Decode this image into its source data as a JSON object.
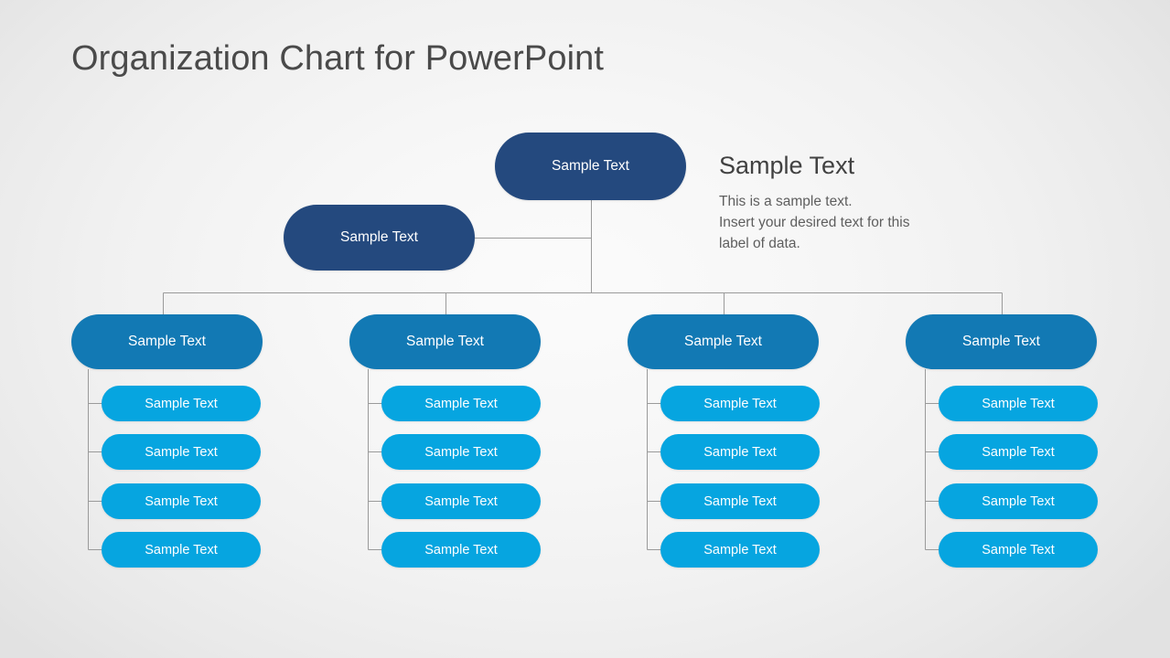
{
  "slide": {
    "title": "Organization Chart for PowerPoint",
    "background_color": "#f4f4f4"
  },
  "annotation": {
    "heading": "Sample Text",
    "body_lines": [
      "This is a sample text.",
      "Insert your desired text for this",
      "label of data."
    ]
  },
  "colors": {
    "level1": "#24497e",
    "level2": "#24497e",
    "level3": "#1279b4",
    "leaf": "#06a5e0",
    "connector": "#9a9a9a",
    "title_text": "#4a4a4a",
    "node_text": "#ffffff"
  },
  "chart": {
    "type": "org-chart",
    "top_node": {
      "label": "Sample Text",
      "level": 1
    },
    "second_node": {
      "label": "Sample Text",
      "level": 2
    },
    "columns": [
      {
        "parent": {
          "label": "Sample Text",
          "level": 3
        },
        "children": [
          {
            "label": "Sample Text"
          },
          {
            "label": "Sample Text"
          },
          {
            "label": "Sample Text"
          },
          {
            "label": "Sample Text"
          }
        ]
      },
      {
        "parent": {
          "label": "Sample Text",
          "level": 3
        },
        "children": [
          {
            "label": "Sample Text"
          },
          {
            "label": "Sample Text"
          },
          {
            "label": "Sample Text"
          },
          {
            "label": "Sample Text"
          }
        ]
      },
      {
        "parent": {
          "label": "Sample Text",
          "level": 3
        },
        "children": [
          {
            "label": "Sample Text"
          },
          {
            "label": "Sample Text"
          },
          {
            "label": "Sample Text"
          },
          {
            "label": "Sample Text"
          }
        ]
      },
      {
        "parent": {
          "label": "Sample Text",
          "level": 3
        },
        "children": [
          {
            "label": "Sample Text"
          },
          {
            "label": "Sample Text"
          },
          {
            "label": "Sample Text"
          },
          {
            "label": "Sample Text"
          }
        ]
      }
    ]
  }
}
